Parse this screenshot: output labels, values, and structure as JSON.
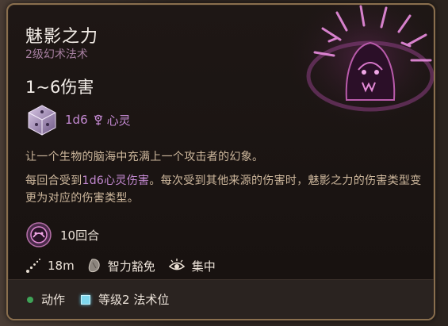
{
  "spell": {
    "name": "魅影之力",
    "level_school": "2级幻术法术",
    "damage": "1~6伤害",
    "dice": "1d6",
    "damage_type": "心灵",
    "description_line1": "让一个生物的脑海中充满上一个攻击者的幻象。",
    "description_p2_a": "每回合受到",
    "description_p2_highlight": "1d6心灵伤害",
    "description_p2_b": "。每次受到其他来源的伤害时，魅影之力的伤害类型变更为对应的伤害类型。",
    "duration": "10回合",
    "range": "18m",
    "save": "智力豁免",
    "concentration": "集中"
  },
  "footer": {
    "action_label": "动作",
    "slot_label": "等级2 法术位"
  },
  "icons": {
    "art": "phantasmal-force-art",
    "dice": "dice-icon",
    "damage_type": "psychic-icon",
    "duration": "duration-icon",
    "range": "range-icon",
    "save": "intelligence-save-icon",
    "concentration": "concentration-icon",
    "action": "action-dot-icon",
    "slot": "spell-slot-icon"
  },
  "colors": {
    "accent_purple": "#c489d2",
    "subtitle": "#a67fa0",
    "body_text": "#cdb79c",
    "border_gold": "#8a6f4e",
    "action_green": "#3fa357",
    "slot_cyan": "#7fd8ee"
  }
}
